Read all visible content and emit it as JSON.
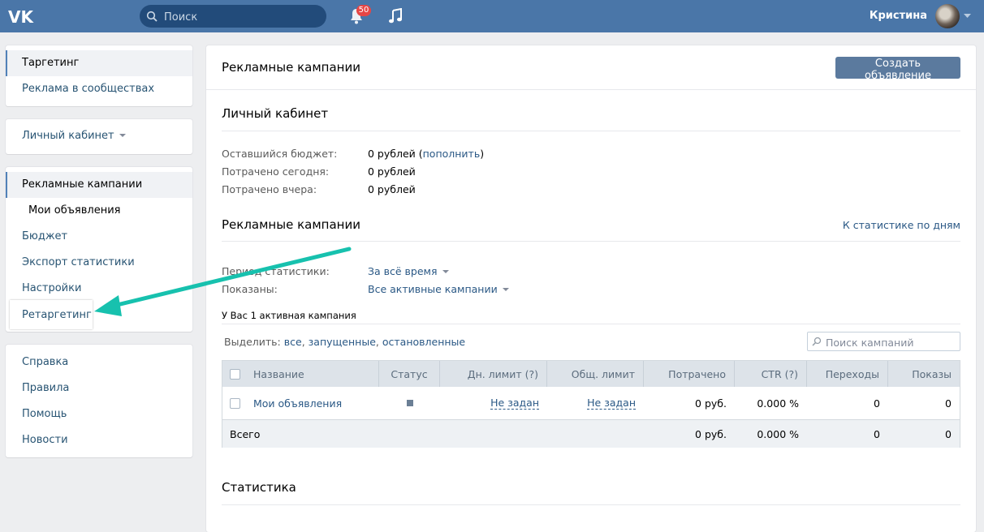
{
  "header": {
    "search_placeholder": "Поиск",
    "notifications_count": "50",
    "user_name": "Кристина",
    "icons": [
      "vk-logo-icon",
      "search-icon",
      "bell-icon",
      "music-icon",
      "chevron-down-icon"
    ],
    "colors": {
      "bar": "#4a76a8",
      "badge": "#e64646"
    }
  },
  "sidebar": {
    "group1": [
      "Таргетинг",
      "Реклама в сообществах"
    ],
    "group2": {
      "cabinet": "Личный кабинет"
    },
    "group3": [
      "Рекламные кампании",
      "Мои объявления",
      "Бюджет",
      "Экспорт статистики",
      "Настройки",
      "Ретаргетинг"
    ],
    "group4": [
      "Справка",
      "Правила",
      "Помощь",
      "Новости"
    ]
  },
  "main": {
    "title": "Рекламные кампании",
    "create_button": "Создать объявление",
    "cabinet": {
      "title": "Личный кабинет",
      "budget_label": "Оставшийся бюджет:",
      "budget_value": "0 рублей (",
      "budget_link": "пополнить",
      "budget_close": ")",
      "today_label": "Потрачено сегодня:",
      "today_value": "0 рублей",
      "yesterday_label": "Потрачено вчера:",
      "yesterday_value": "0 рублей"
    },
    "campaigns": {
      "title": "Рекламные кампании",
      "daily_stats_link": "К статистике по дням",
      "period_label": "Период статистики:",
      "period_value": "За всё время",
      "shown_label": "Показаны:",
      "shown_value": "Все активные кампании",
      "active_count_text": "У Вас 1 активная кампания",
      "select_label": "Выделить:",
      "select_all": "все",
      "select_running": "запущенные",
      "select_stopped": "остановленные",
      "search_placeholder": "Поиск кампаний"
    },
    "table": {
      "headers": [
        "Название",
        "Статус",
        "Дн. лимит (?)",
        "Общ. лимит",
        "Потрачено",
        "CTR (?)",
        "Переходы",
        "Показы"
      ],
      "row": {
        "name": "Мои объявления",
        "daily_limit": "Не задан",
        "total_limit": "Не задан",
        "spent": "0 руб.",
        "ctr": "0.000 %",
        "clicks": "0",
        "views": "0"
      },
      "total": {
        "label": "Всего",
        "spent": "0 руб.",
        "ctr": "0.000 %",
        "clicks": "0",
        "views": "0"
      }
    },
    "stats_title": "Статистика"
  }
}
